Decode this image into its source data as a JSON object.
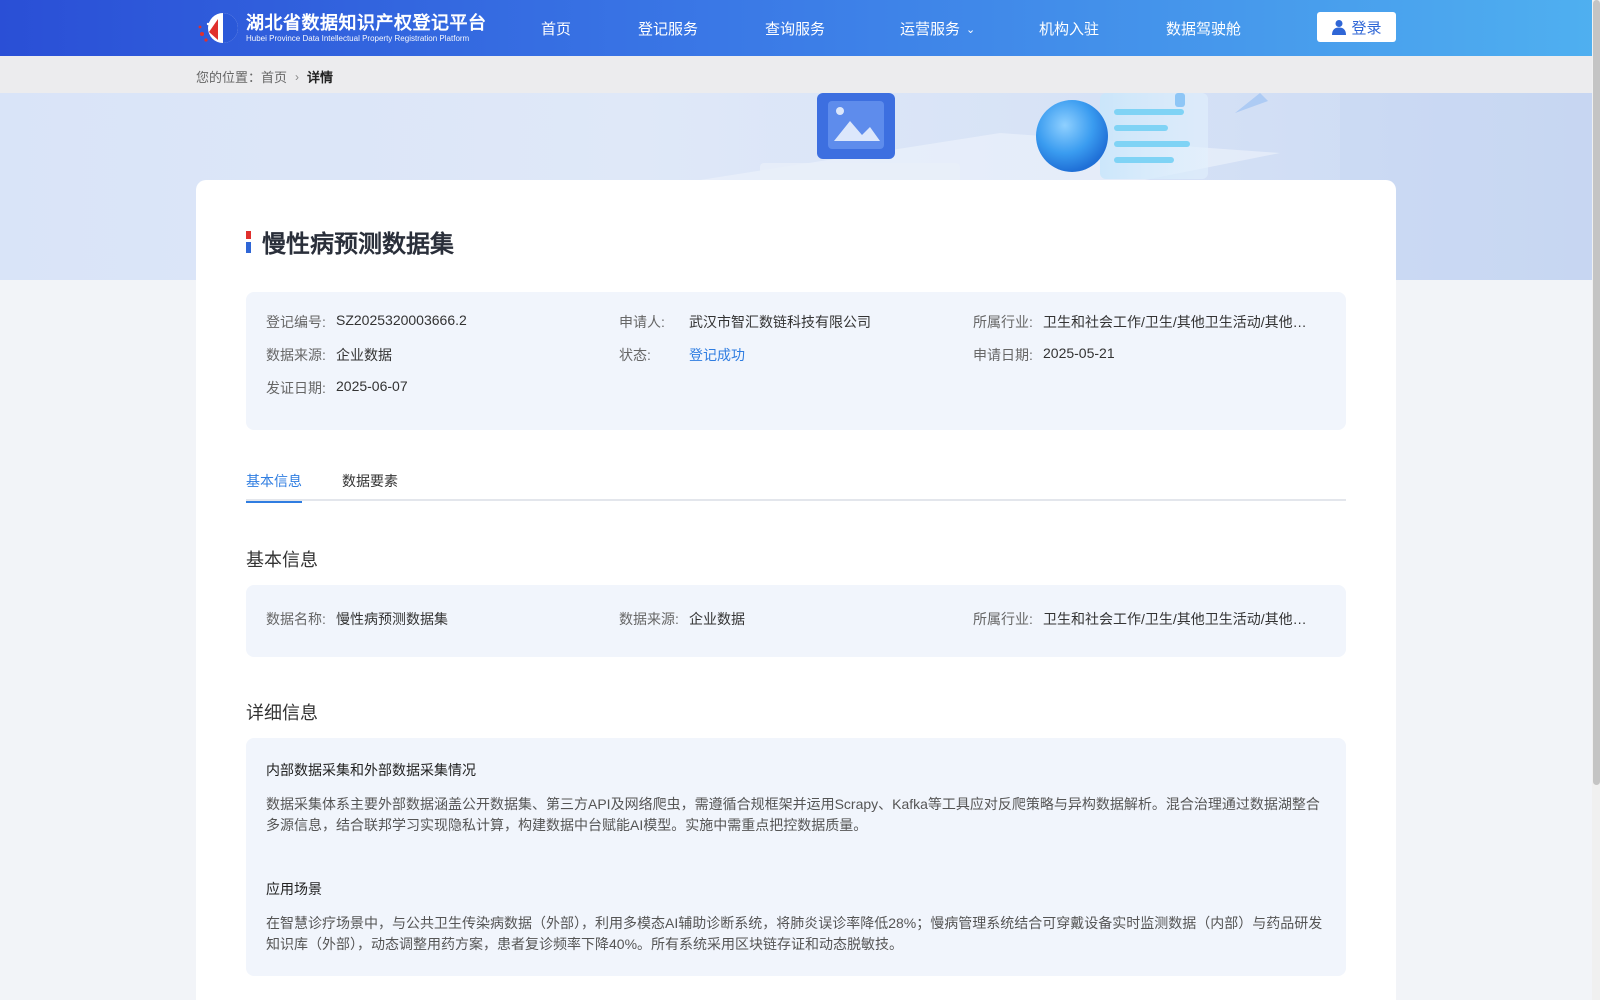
{
  "header": {
    "logo_cn": "湖北省数据知识产权登记平台",
    "logo_en": "Hubei Province Data Intellectual Property Registration Platform",
    "nav": [
      "首页",
      "登记服务",
      "查询服务",
      "运营服务",
      "机构入驻",
      "数据驾驶舱"
    ],
    "login_label": "登录"
  },
  "breadcrumb": {
    "prefix": "您的位置：",
    "home": "首页",
    "current": "详情"
  },
  "detail": {
    "title": "慢性病预测数据集",
    "summary": [
      {
        "label": "登记编号:",
        "value": "SZ2025320003666.2"
      },
      {
        "label": "申请人:",
        "value": "武汉市智汇数链科技有限公司"
      },
      {
        "label": "所属行业:",
        "value": "卫生和社会工作/卫生/其他卫生活动/其他卫生活动"
      },
      {
        "label": "数据来源:",
        "value": "企业数据"
      },
      {
        "label": "状态:",
        "value": "登记成功"
      },
      {
        "label": "申请日期:",
        "value": "2025-05-21"
      },
      {
        "label": "发证日期:",
        "value": "2025-06-07"
      }
    ],
    "tabs": [
      "基本信息",
      "数据要素"
    ],
    "basic_title": "基本信息",
    "basic": [
      {
        "label": "数据名称:",
        "value": "慢性病预测数据集"
      },
      {
        "label": "数据来源:",
        "value": "企业数据"
      },
      {
        "label": "所属行业:",
        "value": "卫生和社会工作/卫生/其他卫生活动/其他卫生活动"
      }
    ],
    "detail_title": "详细信息",
    "sections": [
      {
        "heading": "内部数据采集和外部数据采集情况",
        "text": "数据采集体系主要外部数据涵盖公开数据集、第三方API及网络爬虫，需遵循合规框架并运用Scrapy、Kafka等工具应对反爬策略与异构数据解析。混合治理通过数据湖整合多源信息，结合联邦学习实现隐私计算，构建数据中台赋能AI模型。实施中需重点把控数据质量。"
      },
      {
        "heading": "应用场景",
        "text": "在智慧诊疗场景中，与公共卫生传染病数据（外部），利用多模态AI辅助诊断系统，将肺炎误诊率降低28%；慢病管理系统结合可穿戴设备实时监测数据（内部）与药品研发知识库（外部），动态调整用药方案，患者复诊频率下降40%。所有系统采用区块链存证和动态脱敏技。"
      }
    ]
  },
  "colors": {
    "header_start": "#2a4fd6",
    "header_end": "#4fb0f0",
    "accent": "#2f7de1",
    "panel_bg": "#f1f5fc"
  }
}
